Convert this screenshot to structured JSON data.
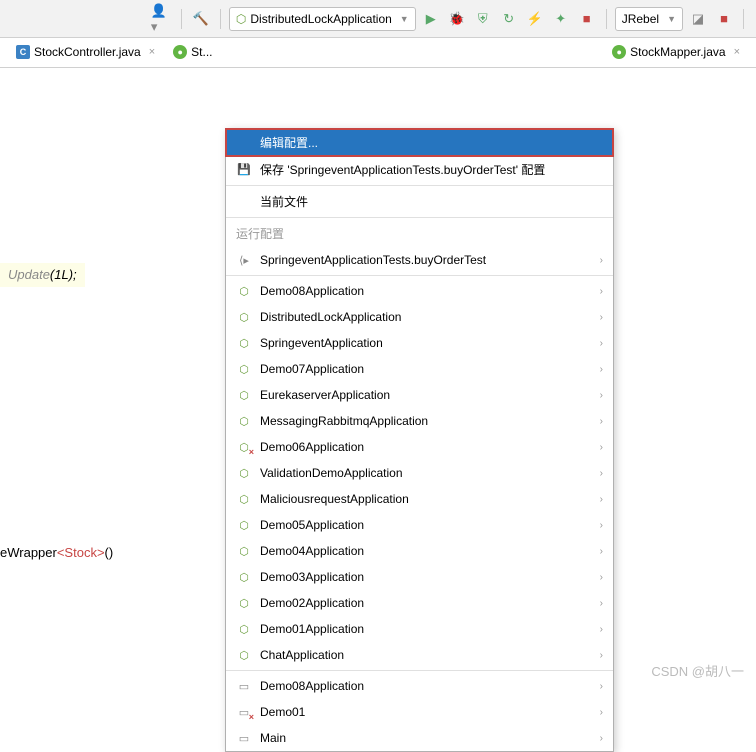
{
  "toolbar": {
    "run_config_label": "DistributedLockApplication",
    "jrebel_label": "JRebel"
  },
  "tabs": [
    {
      "icon": "c",
      "label": "StockController.java"
    },
    {
      "icon": "j",
      "label": "St..."
    },
    {
      "icon": "m",
      "label": "StockMapper.java"
    }
  ],
  "code": {
    "line1_prefix": "Update",
    "line1_args": "(1L);",
    "line2_prefix": "eWrapper",
    "line2_generic": "<Stock>",
    "line2_suffix": "()"
  },
  "dropdown": {
    "edit_config": "编辑配置...",
    "save_config": "保存 'SpringeventApplicationTests.buyOrderTest' 配置",
    "current_file": "当前文件",
    "run_config_header": "运行配置",
    "items_test": [
      {
        "label": "SpringeventApplicationTests.buyOrderTest",
        "icon": "run"
      }
    ],
    "items_spring": [
      {
        "label": "Demo08Application",
        "icon": "spring"
      },
      {
        "label": "DistributedLockApplication",
        "icon": "spring"
      },
      {
        "label": "SpringeventApplication",
        "icon": "spring"
      },
      {
        "label": "Demo07Application",
        "icon": "spring"
      },
      {
        "label": "EurekaserverApplication",
        "icon": "spring"
      },
      {
        "label": "MessagingRabbitmqApplication",
        "icon": "spring"
      },
      {
        "label": "Demo06Application",
        "icon": "spring-err"
      },
      {
        "label": "ValidationDemoApplication",
        "icon": "spring"
      },
      {
        "label": "MaliciousrequestApplication",
        "icon": "spring"
      },
      {
        "label": "Demo05Application",
        "icon": "spring"
      },
      {
        "label": "Demo04Application",
        "icon": "spring"
      },
      {
        "label": "Demo03Application",
        "icon": "spring"
      },
      {
        "label": "Demo02Application",
        "icon": "spring"
      },
      {
        "label": "Demo01Application",
        "icon": "spring"
      },
      {
        "label": "ChatApplication",
        "icon": "spring"
      }
    ],
    "items_app": [
      {
        "label": "Demo08Application",
        "icon": "app"
      },
      {
        "label": "Demo01",
        "icon": "app-err"
      },
      {
        "label": "Main",
        "icon": "app"
      }
    ]
  },
  "watermark": "CSDN @胡八一"
}
